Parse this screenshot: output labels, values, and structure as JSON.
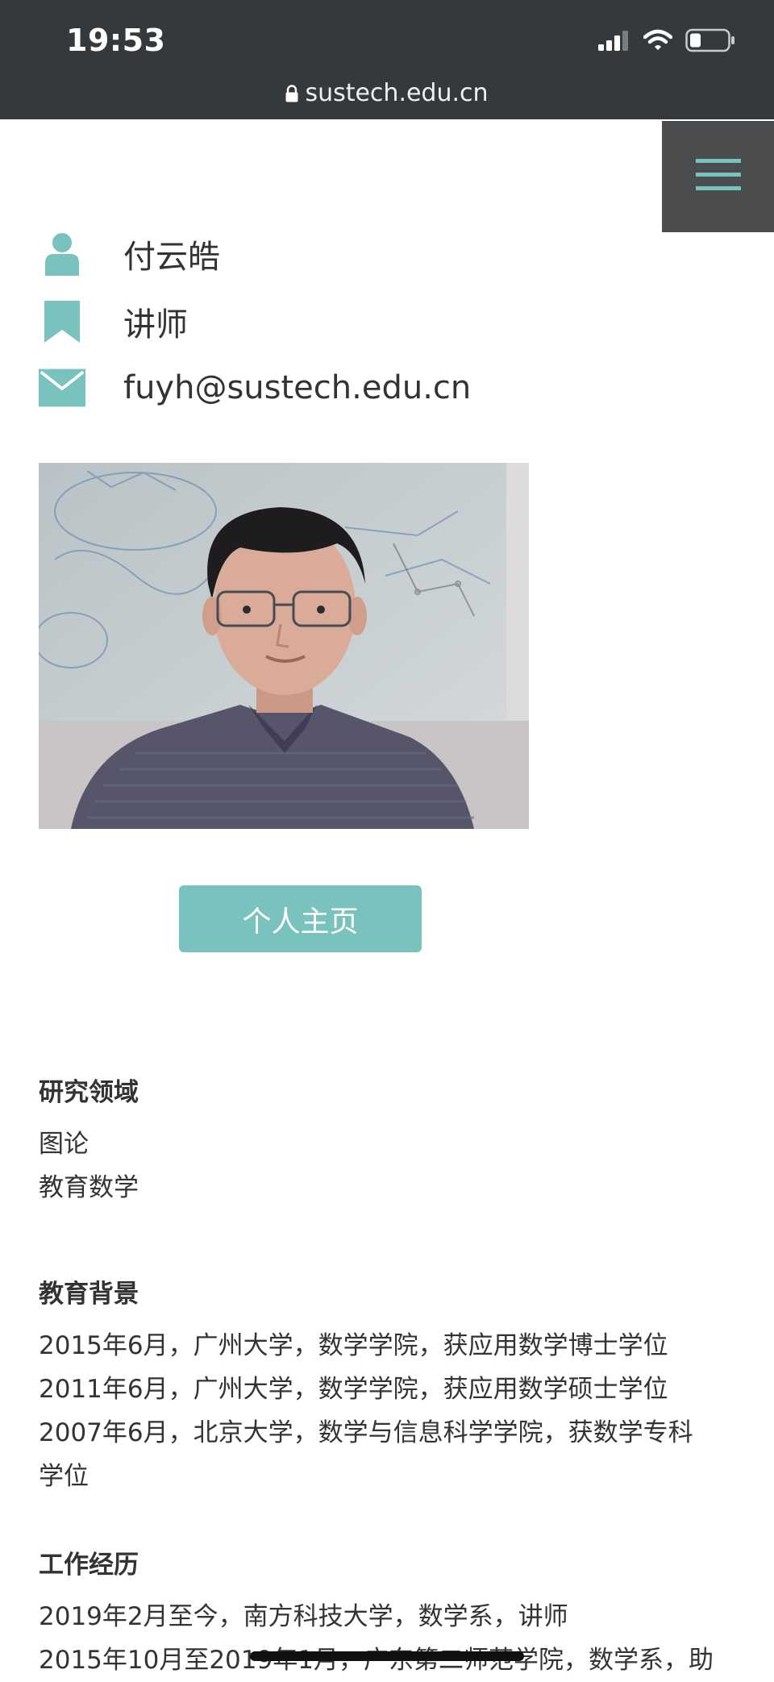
{
  "status_bar": {
    "time": "19:53",
    "url": "sustech.edu.cn"
  },
  "profile": {
    "name": "付云皓",
    "title": "讲师",
    "email": "fuyh@sustech.edu.cn",
    "homepage_button": "个人主页"
  },
  "research": {
    "heading": "研究领域",
    "items": [
      "图论",
      "教育数学"
    ]
  },
  "education": {
    "heading": "教育背景",
    "items": [
      "2015年6月，广州大学，数学学院，获应用数学博士学位",
      "2011年6月，广州大学，数学学院，获应用数学硕士学位",
      "2007年6月，北京大学，数学与信息科学学院，获数学专科",
      "学位"
    ]
  },
  "work": {
    "heading": "工作经历",
    "items": [
      "2019年2月至今，南方科技大学，数学系，讲师",
      "2015年10月至2019年1月，广东第二师范学院，数学系，助"
    ]
  },
  "colors": {
    "accent": "#79c2be",
    "statusbar": "#36393b",
    "menu": "#4a4c4e"
  },
  "icons": [
    "user-icon",
    "bookmark-icon",
    "mail-icon",
    "menu-icon",
    "lock-icon",
    "signal-icon",
    "wifi-icon",
    "battery-icon"
  ]
}
